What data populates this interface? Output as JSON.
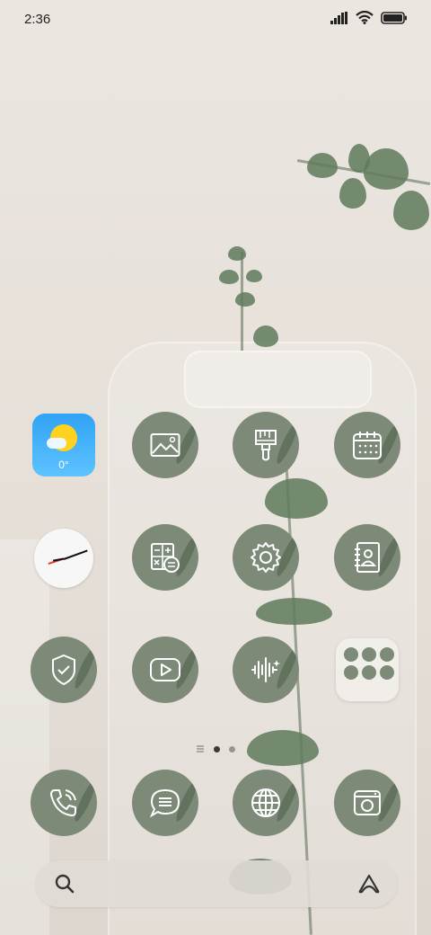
{
  "status_bar": {
    "time": "2:36"
  },
  "weather": {
    "temperature": "0°"
  },
  "apps": {
    "row1": [
      "weather-widget",
      "gallery-icon",
      "theme-brush-icon",
      "calendar-icon"
    ],
    "row2": [
      "clock-widget",
      "calculator-icon",
      "settings-gear-icon",
      "contacts-icon"
    ],
    "row3": [
      "security-shield-icon",
      "video-play-icon",
      "recorder-icon",
      "app-folder"
    ],
    "dock": [
      "phone-icon",
      "messages-icon",
      "browser-globe-icon",
      "camera-icon"
    ]
  },
  "page_indicator": {
    "pages": 2,
    "active": 1
  },
  "search": {
    "placeholder": ""
  },
  "colors": {
    "icon_bg": "#7d8a78",
    "wallpaper": "#e7e1da"
  }
}
